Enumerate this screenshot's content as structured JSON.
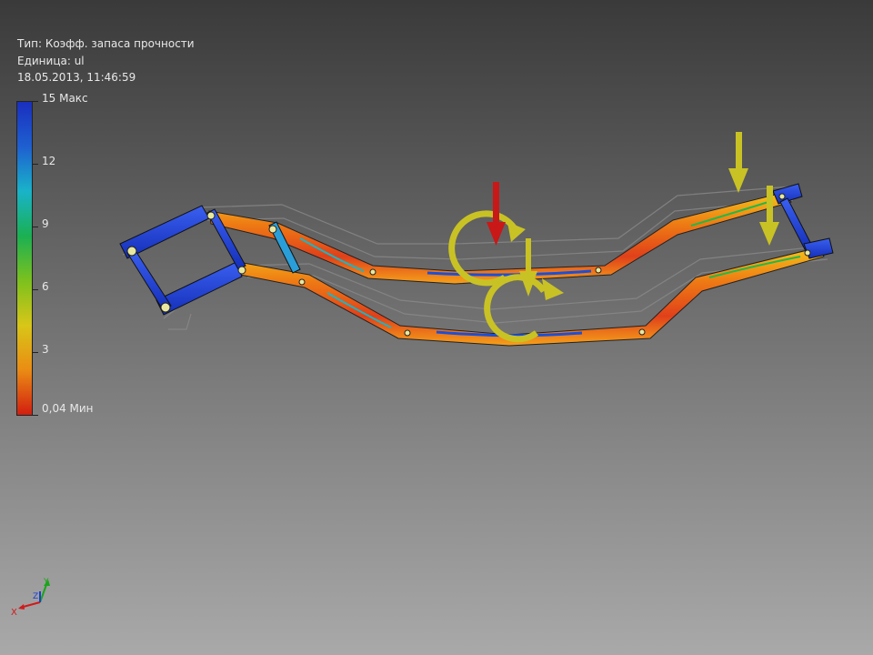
{
  "info": {
    "type_line": "Тип: Коэфф. запаса прочности",
    "unit_line": "Единица: ul",
    "datetime_line": "18.05.2013, 11:46:59"
  },
  "legend": {
    "gradient_colors": [
      "#1a2fbf",
      "#1e5fd0",
      "#19b3c9",
      "#1bb052",
      "#7cc11e",
      "#d8c618",
      "#ea8c14",
      "#d21e10"
    ],
    "max_label": "15 Макс",
    "min_label": "0,04 Мин",
    "ticks": [
      "15 Макс",
      "12",
      "9",
      "6",
      "3",
      "0,04 Мин"
    ]
  },
  "triad": {
    "x_label": "X",
    "y_label": "Y",
    "z_label": "Z",
    "x_color": "#d11a1a",
    "y_color": "#1aa51a",
    "z_color": "#1a3fd1"
  },
  "model": {
    "load_arrow_color": "#c9c224",
    "primary_load_color": "#c81818",
    "frame_hot_color": "#e8501a",
    "frame_safe_color": "#1c3fd8"
  }
}
